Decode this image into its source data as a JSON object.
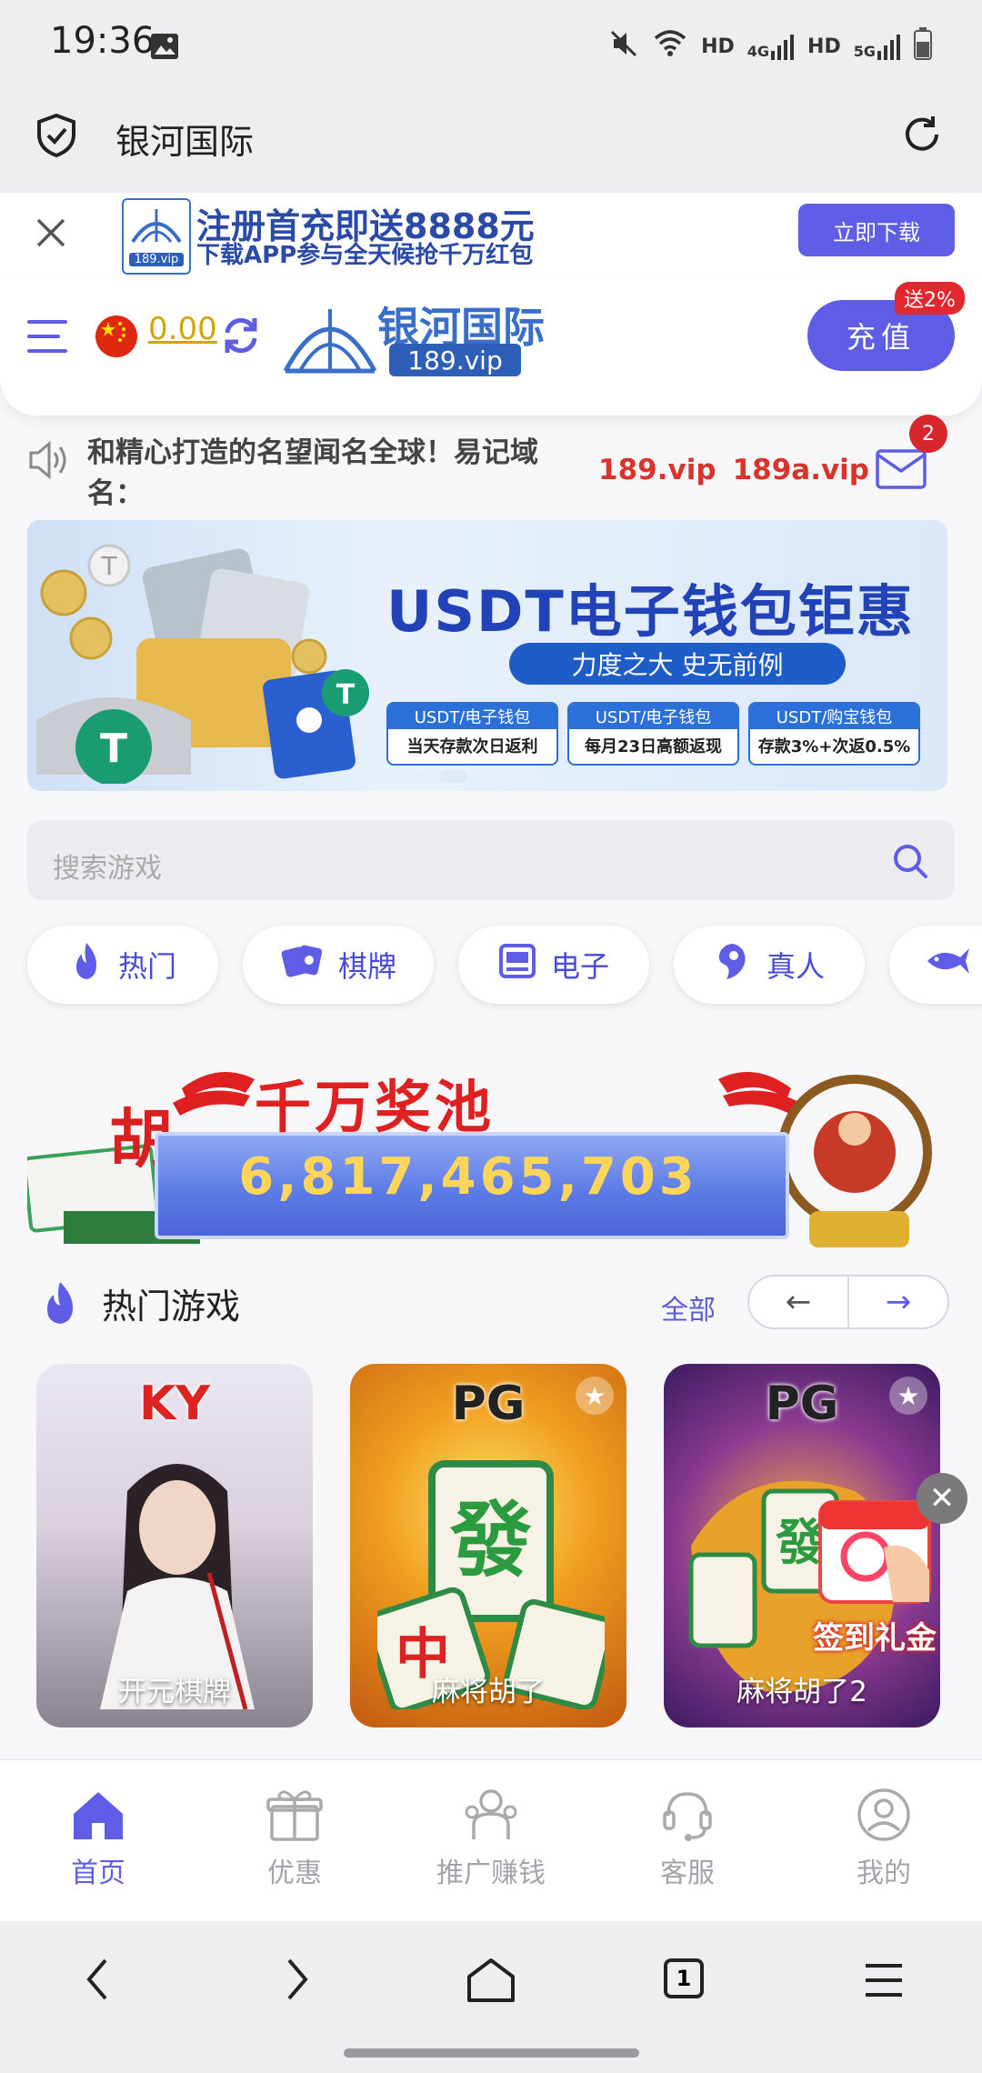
{
  "status_bar": {
    "time": "19:36",
    "icons": [
      "image-icon",
      "mute-icon",
      "wifi-icon",
      "HD",
      "4G",
      "HD",
      "5G",
      "battery-icon"
    ],
    "hd1": "HD",
    "net1": "4G",
    "hd2": "HD",
    "net2": "5G"
  },
  "browser": {
    "title": "银河国际"
  },
  "promo": {
    "line1": "注册首充即送8888元",
    "line2": "下载APP参与全天候抢千万红包",
    "logo_small": "189.vip",
    "download_label": "立即下载"
  },
  "header": {
    "balance": "0.00",
    "logo_title": "银河国际",
    "logo_sub": "189.vip",
    "recharge_label": "充值",
    "bonus_badge": "送2%"
  },
  "notice": {
    "text": "和精心打造的名望闻名全球！易记域名：",
    "domain1": "189.vip",
    "domain2": "189a.vip",
    "mail_count": "2"
  },
  "banner": {
    "title": "USDT电子钱包钜惠",
    "slogan": "力度之大 史无前例",
    "boxes": [
      {
        "head": "USDT/电子钱包",
        "body": "当天存款次日返利"
      },
      {
        "head": "USDT/电子钱包",
        "body": "每月23日高额返现"
      },
      {
        "head": "USDT/购宝钱包",
        "body": "存款3%+次返0.5%"
      }
    ]
  },
  "search": {
    "placeholder": "搜索游戏"
  },
  "categories": [
    "热门",
    "棋牌",
    "电子",
    "真人"
  ],
  "jackpot": {
    "title": "千万奖池",
    "amount": "6,817,465,703"
  },
  "hot_games": {
    "title": "热门游戏",
    "all_label": "全部",
    "games": [
      {
        "brand": "KY",
        "name": "开元棋牌"
      },
      {
        "brand": "PG",
        "name": "麻将胡了"
      },
      {
        "brand": "PG",
        "name": "麻将胡了2"
      }
    ]
  },
  "signin_popup": {
    "label": "签到礼金"
  },
  "bottom_nav": [
    {
      "label": "首页",
      "icon": "home-icon"
    },
    {
      "label": "优惠",
      "icon": "gift-icon"
    },
    {
      "label": "推广赚钱",
      "icon": "referral-icon"
    },
    {
      "label": "客服",
      "icon": "support-icon"
    },
    {
      "label": "我的",
      "icon": "profile-icon"
    }
  ],
  "system_nav": {
    "tab_count": "1"
  },
  "colors": {
    "accent": "#5f5ce6",
    "red": "#d7342b",
    "gold": "#d4a400"
  }
}
